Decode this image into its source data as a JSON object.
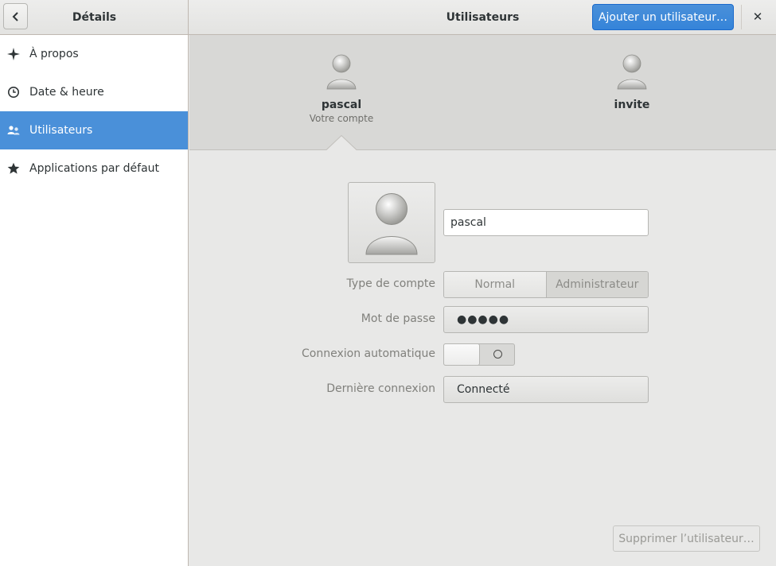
{
  "header": {
    "left_title": "Détails",
    "title": "Utilisateurs",
    "add_user_label": "Ajouter un utilisateur…",
    "close_label": "✕",
    "accent_color": "#4a90d9"
  },
  "sidebar": {
    "items": [
      {
        "label": "À propos",
        "icon": "sparkle-icon",
        "active": false
      },
      {
        "label": "Date & heure",
        "icon": "clock-icon",
        "active": false
      },
      {
        "label": "Utilisateurs",
        "icon": "users-icon",
        "active": true
      },
      {
        "label": "Applications par défaut",
        "icon": "star-icon",
        "active": false
      }
    ]
  },
  "users": [
    {
      "name": "pascal",
      "subtitle": "Votre compte",
      "selected": true
    },
    {
      "name": "invite",
      "subtitle": "",
      "selected": false
    }
  ],
  "details": {
    "name_value": "pascal",
    "account_type_label": "Type de compte",
    "account_type_options": [
      "Normal",
      "Administrateur"
    ],
    "account_type_selected": "Administrateur",
    "password_label": "Mot de passe",
    "password_value": "●●●●●",
    "autologin_label": "Connexion automatique",
    "autologin_on": false,
    "last_login_label": "Dernière connexion",
    "last_login_value": "Connecté"
  },
  "footer": {
    "delete_label": "Supprimer l’utilisateur…"
  }
}
